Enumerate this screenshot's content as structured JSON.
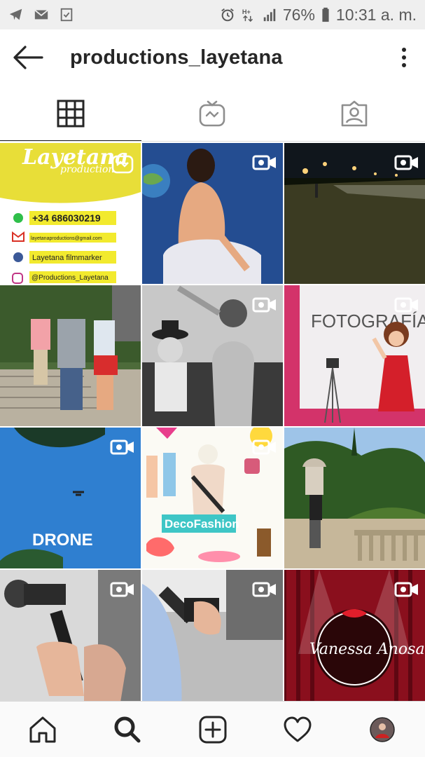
{
  "status_bar": {
    "battery": "76%",
    "time": "10:31 a. m.",
    "left_icons": [
      "telegram-icon",
      "gmail-icon",
      "checkbox-notification-icon"
    ],
    "right_icons": [
      "alarm-icon",
      "data-icon",
      "signal-icon",
      "battery-icon"
    ]
  },
  "header": {
    "username": "productions_layetana"
  },
  "tabs": [
    {
      "name": "grid-icon",
      "active": true
    },
    {
      "name": "igtv-icon",
      "active": false
    },
    {
      "name": "tagged-icon",
      "active": false
    }
  ],
  "posts": {
    "p1": {
      "title": "Layetana",
      "subtitle": "production",
      "phone": "+34 686030219",
      "email": "layetanaproductions@gmail.com",
      "facebook": "Layetana filmmarker",
      "instagram": "@Productions_Layetana"
    },
    "p6": {
      "text": "FOTOGRAFÍA"
    },
    "p7": {
      "text": "DRONE"
    },
    "p8": {
      "text": "DecoFashion"
    },
    "p12": {
      "text": "Vanessa Anosa"
    }
  },
  "colors": {
    "accent_yellow": "#e8de38",
    "pink": "#d3336a",
    "drone_sky": "#2f7fd0",
    "deco_teal": "#3ec6c6",
    "curtain_red": "#8a0f1d"
  },
  "bottom_nav": [
    "home-icon",
    "search-icon",
    "add-post-icon",
    "activity-heart-icon",
    "profile-avatar"
  ]
}
